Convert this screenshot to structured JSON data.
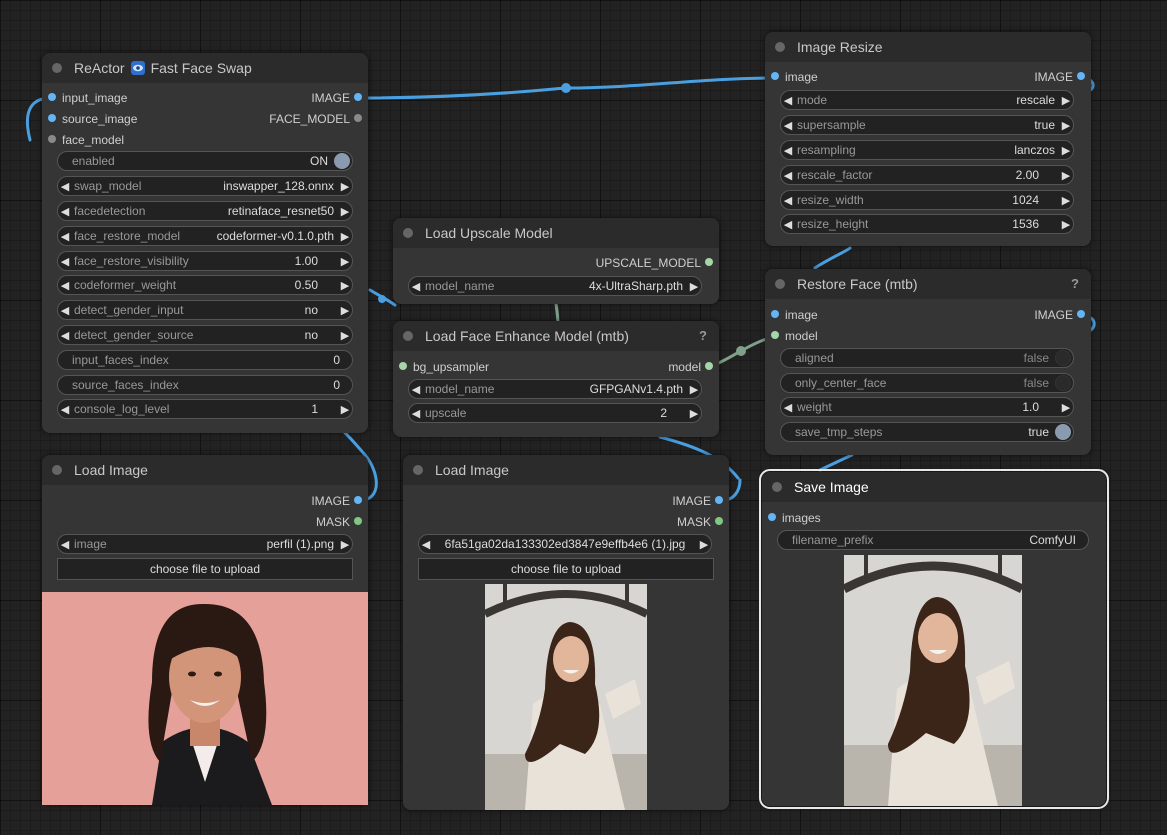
{
  "nodes": {
    "reactor": {
      "title_a": "ReActor",
      "title_b": "Fast Face Swap",
      "inputs": [
        "input_image",
        "source_image",
        "face_model"
      ],
      "outputs": [
        "IMAGE",
        "FACE_MODEL"
      ],
      "enabled": {
        "label": "enabled",
        "value": "ON"
      },
      "widgets": [
        {
          "label": "swap_model",
          "value": "inswapper_128.onnx"
        },
        {
          "label": "facedetection",
          "value": "retinaface_resnet50"
        },
        {
          "label": "face_restore_model",
          "value": "codeformer-v0.1.0.pth"
        },
        {
          "label": "face_restore_visibility",
          "value": "1.00"
        },
        {
          "label": "codeformer_weight",
          "value": "0.50"
        },
        {
          "label": "detect_gender_input",
          "value": "no"
        },
        {
          "label": "detect_gender_source",
          "value": "no"
        }
      ],
      "plain_widgets": [
        {
          "label": "input_faces_index",
          "value": "0"
        },
        {
          "label": "source_faces_index",
          "value": "0"
        }
      ],
      "console": {
        "label": "console_log_level",
        "value": "1"
      }
    },
    "upscale": {
      "title": "Load Upscale Model",
      "output": "UPSCALE_MODEL",
      "model_name": {
        "label": "model_name",
        "value": "4x-UltraSharp.pth"
      }
    },
    "enhance": {
      "title": "Load Face Enhance Model (mtb)",
      "help": "?",
      "input": "bg_upsampler",
      "output": "model",
      "model_name": {
        "label": "model_name",
        "value": "GFPGANv1.4.pth"
      },
      "upscale": {
        "label": "upscale",
        "value": "2"
      }
    },
    "resize": {
      "title": "Image Resize",
      "input": "image",
      "output": "IMAGE",
      "widgets": [
        {
          "label": "mode",
          "value": "rescale"
        },
        {
          "label": "supersample",
          "value": "true"
        },
        {
          "label": "resampling",
          "value": "lanczos"
        },
        {
          "label": "rescale_factor",
          "value": "2.00"
        },
        {
          "label": "resize_width",
          "value": "1024"
        },
        {
          "label": "resize_height",
          "value": "1536"
        }
      ]
    },
    "restore": {
      "title": "Restore Face (mtb)",
      "help": "?",
      "inputs": [
        "image",
        "model"
      ],
      "output": "IMAGE",
      "aligned": {
        "label": "aligned",
        "value": "false"
      },
      "only_center_face": {
        "label": "only_center_face",
        "value": "false"
      },
      "weight": {
        "label": "weight",
        "value": "1.0"
      },
      "save_tmp_steps": {
        "label": "save_tmp_steps",
        "value": "true"
      }
    },
    "load1": {
      "title": "Load Image",
      "outputs": [
        "IMAGE",
        "MASK"
      ],
      "image": {
        "label": "image",
        "value": "perfil (1).png"
      },
      "upload": "choose file to upload"
    },
    "load2": {
      "title": "Load Image",
      "outputs": [
        "IMAGE",
        "MASK"
      ],
      "image": {
        "label": "",
        "value": "6fa51ga02da133302ed3847e9effb4e6 (1).jpg"
      },
      "upload": "choose file to upload"
    },
    "save": {
      "title": "Save Image",
      "input": "images",
      "filename_prefix": {
        "label": "filename_prefix",
        "value": "ComfyUI"
      }
    }
  },
  "colors": {
    "image_link": "#4a9fe0",
    "model_link": "#7fa08a",
    "image_slot": "#64b5f6",
    "mask_slot": "#81c784"
  }
}
